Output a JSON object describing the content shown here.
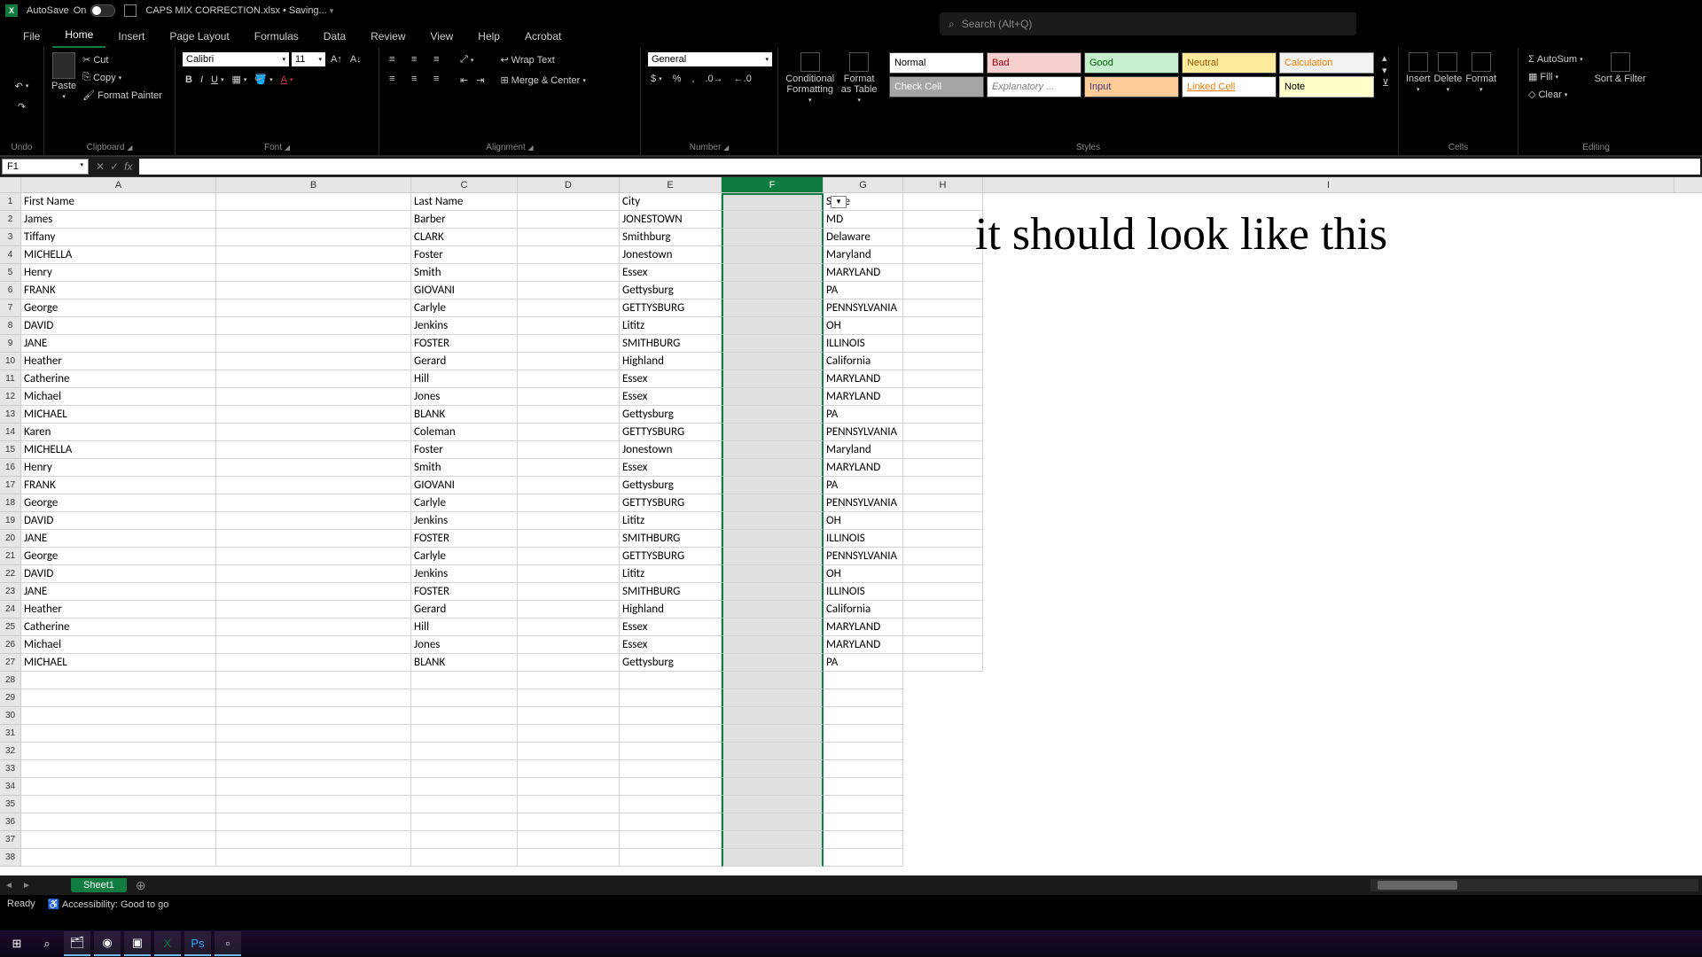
{
  "title": {
    "autosave": "AutoSave",
    "autosave_state": "On",
    "filename": "CAPS MIX CORRECTION.xlsx • Saving..."
  },
  "search": {
    "placeholder": "Search (Alt+Q)"
  },
  "menu": [
    "File",
    "Home",
    "Insert",
    "Page Layout",
    "Formulas",
    "Data",
    "Review",
    "View",
    "Help",
    "Acrobat"
  ],
  "active_menu": 1,
  "ribbon": {
    "undo": "Undo",
    "clipboard": {
      "label": "Clipboard",
      "paste": "Paste",
      "cut": "Cut",
      "copy": "Copy",
      "painter": "Format Painter"
    },
    "font": {
      "label": "Font",
      "name": "Calibri",
      "size": "11"
    },
    "alignment": {
      "label": "Alignment",
      "wrap": "Wrap Text",
      "merge": "Merge & Center"
    },
    "number": {
      "label": "Number",
      "format": "General"
    },
    "cond": "Conditional Formatting",
    "fat": "Format as Table",
    "styles_label": "Styles",
    "styles": [
      "Normal",
      "Bad",
      "Good",
      "Neutral",
      "Calculation",
      "Check Cell",
      "Explanatory ...",
      "Input",
      "Linked Cell",
      "Note"
    ],
    "style_colors": [
      {
        "bg": "#ffffff",
        "fg": "#000"
      },
      {
        "bg": "#f8cfcf",
        "fg": "#9c0006"
      },
      {
        "bg": "#c6efce",
        "fg": "#006100"
      },
      {
        "bg": "#ffeb9c",
        "fg": "#9c5700"
      },
      {
        "bg": "#f2f2f2",
        "fg": "#fa7d00",
        "bd": "#7f7f7f"
      },
      {
        "bg": "#a5a5a5",
        "fg": "#fff"
      },
      {
        "bg": "#fff",
        "fg": "#7f7f7f",
        "it": true
      },
      {
        "bg": "#ffcc99",
        "fg": "#3f3f76"
      },
      {
        "bg": "#fff",
        "fg": "#fa7d00",
        "ul": true
      },
      {
        "bg": "#ffffcc",
        "fg": "#000",
        "bd": "#b2b2b2"
      }
    ],
    "cells": {
      "label": "Cells",
      "insert": "Insert",
      "delete": "Delete",
      "format": "Format"
    },
    "editing": {
      "label": "Editing",
      "autosum": "AutoSum",
      "fill": "Fill",
      "clear": "Clear",
      "sort": "Sort & Filter"
    }
  },
  "name_box": "F1",
  "columns": [
    "A",
    "B",
    "C",
    "D",
    "E",
    "F",
    "G",
    "H",
    "I"
  ],
  "selected_col": 5,
  "row_count": 38,
  "overlay": "it should look like this",
  "data_rows": [
    [
      "First Name",
      "",
      "Last Name",
      "",
      "City",
      "",
      "State",
      ""
    ],
    [
      "James",
      "",
      "Barber",
      "",
      "JONESTOWN",
      "",
      "MD",
      ""
    ],
    [
      "Tiffany",
      "",
      "CLARK",
      "",
      "Smithburg",
      "",
      "Delaware",
      ""
    ],
    [
      "MICHELLA",
      "",
      "Foster",
      "",
      "Jonestown",
      "",
      "Maryland",
      ""
    ],
    [
      "Henry",
      "",
      "Smith",
      "",
      "Essex",
      "",
      "MARYLAND",
      ""
    ],
    [
      "FRANK",
      "",
      "GIOVANI",
      "",
      "Gettysburg",
      "",
      "PA",
      ""
    ],
    [
      "George",
      "",
      "Carlyle",
      "",
      "GETTYSBURG",
      "",
      "PENNSYLVANIA",
      ""
    ],
    [
      "DAVID",
      "",
      "Jenkins",
      "",
      "Lititz",
      "",
      "OH",
      ""
    ],
    [
      "JANE",
      "",
      "FOSTER",
      "",
      "SMITHBURG",
      "",
      "ILLINOIS",
      ""
    ],
    [
      "Heather",
      "",
      "Gerard",
      "",
      "Highland",
      "",
      "California",
      ""
    ],
    [
      "Catherine",
      "",
      "Hill",
      "",
      "Essex",
      "",
      "MARYLAND",
      ""
    ],
    [
      "Michael",
      "",
      "Jones",
      "",
      "Essex",
      "",
      "MARYLAND",
      ""
    ],
    [
      "MICHAEL",
      "",
      "BLANK",
      "",
      "Gettysburg",
      "",
      "PA",
      ""
    ],
    [
      "Karen",
      "",
      "Coleman",
      "",
      "GETTYSBURG",
      "",
      "PENNSYLVANIA",
      ""
    ],
    [
      "MICHELLA",
      "",
      "Foster",
      "",
      "Jonestown",
      "",
      "Maryland",
      ""
    ],
    [
      "Henry",
      "",
      "Smith",
      "",
      "Essex",
      "",
      "MARYLAND",
      ""
    ],
    [
      "FRANK",
      "",
      "GIOVANI",
      "",
      "Gettysburg",
      "",
      "PA",
      ""
    ],
    [
      "George",
      "",
      "Carlyle",
      "",
      "GETTYSBURG",
      "",
      "PENNSYLVANIA",
      ""
    ],
    [
      "DAVID",
      "",
      "Jenkins",
      "",
      "Lititz",
      "",
      "OH",
      ""
    ],
    [
      "JANE",
      "",
      "FOSTER",
      "",
      "SMITHBURG",
      "",
      "ILLINOIS",
      ""
    ],
    [
      "George",
      "",
      "Carlyle",
      "",
      "GETTYSBURG",
      "",
      "PENNSYLVANIA",
      ""
    ],
    [
      "DAVID",
      "",
      "Jenkins",
      "",
      "Lititz",
      "",
      "OH",
      ""
    ],
    [
      "JANE",
      "",
      "FOSTER",
      "",
      "SMITHBURG",
      "",
      "ILLINOIS",
      ""
    ],
    [
      "Heather",
      "",
      "Gerard",
      "",
      "Highland",
      "",
      "California",
      ""
    ],
    [
      "Catherine",
      "",
      "Hill",
      "",
      "Essex",
      "",
      "MARYLAND",
      ""
    ],
    [
      "Michael",
      "",
      "Jones",
      "",
      "Essex",
      "",
      "MARYLAND",
      ""
    ],
    [
      "MICHAEL",
      "",
      "BLANK",
      "",
      "Gettysburg",
      "",
      "PA",
      ""
    ]
  ],
  "sheet": "Sheet1",
  "status": {
    "ready": "Ready",
    "access": "Accessibility: Good to go"
  }
}
